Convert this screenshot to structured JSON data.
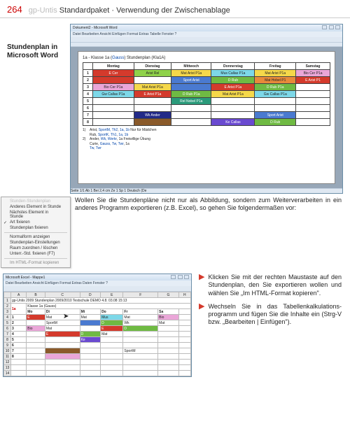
{
  "page": {
    "number": "264",
    "title_grey": "gp-Untis",
    "title_rest": " Standardpaket · Verwendung der Zwischenablage"
  },
  "caption1": "Stundenplan in Microsoft Word",
  "word": {
    "title": "Dokument2 - Microsoft Word",
    "menu": "Datei  Bearbeiten  Ansicht  Einfügen  Format  Extras  Tabelle  Fenster  ?",
    "doc_title_pre": "1a - Klasse 1a (",
    "doc_title_blue": "Gauss",
    "doc_title_post": ") Stundenplan (Kla1A)",
    "days": [
      "",
      "Montag",
      "Dienstag",
      "Mittwoch",
      "Donnerstag",
      "Freitag",
      "Samstag"
    ],
    "rows": [
      {
        "n": "1",
        "cells": [
          {
            "t": "E Cer",
            "c": "c-red"
          },
          {
            "t": "Arist  Rel",
            "c": "c-lime"
          },
          {
            "t": "Mat  Arist P1a",
            "c": "c-yellow"
          },
          {
            "t": "Mus Callas P1a",
            "c": "c-cyan"
          },
          {
            "t": "Mat  Arist P1a",
            "c": "c-yellow"
          },
          {
            "t": "Bio  Cer  P1a",
            "c": "c-pink"
          }
        ]
      },
      {
        "n": "2",
        "cells": [
          {
            "t": "",
            "c": "c-red"
          },
          {
            "t": "",
            "c": ""
          },
          {
            "t": "Sport  Arist",
            "c": "c-blue"
          },
          {
            "t": "D  Rub",
            "c": "c-lime2"
          },
          {
            "t": "Mat  Hobel P1",
            "c": "c-orange"
          },
          {
            "t": "E  Arist P1",
            "c": "c-red"
          }
        ]
      },
      {
        "n": "3",
        "cells": [
          {
            "t": "Bio  Cer P1a",
            "c": "c-pink"
          },
          {
            "t": "Mat  Arist P1a",
            "c": "c-yellow"
          },
          {
            "t": "",
            "c": "c-blue"
          },
          {
            "t": "E  Arist P1a",
            "c": "c-red"
          },
          {
            "t": "D  Rub  P1a",
            "c": "c-lime2"
          },
          {
            "t": "",
            "c": ""
          }
        ]
      },
      {
        "n": "4",
        "cells": [
          {
            "t": "Gw  Callas P1a",
            "c": "c-cyan"
          },
          {
            "t": "E  Arist P1a",
            "c": "c-red"
          },
          {
            "t": "D  Rub  P1a",
            "c": "c-lime2"
          },
          {
            "t": "Mat  Arist P1a",
            "c": "c-yellow"
          },
          {
            "t": "Gw  Callas P1a",
            "c": "c-cyan"
          },
          {
            "t": "",
            "c": ""
          }
        ]
      },
      {
        "n": "5",
        "cells": [
          {
            "t": "",
            "c": ""
          },
          {
            "t": "",
            "c": ""
          },
          {
            "t": "Rel  Nobel P1a",
            "c": "c-teal"
          },
          {
            "t": "",
            "c": ""
          },
          {
            "t": "",
            "c": ""
          },
          {
            "t": "",
            "c": ""
          }
        ]
      },
      {
        "n": "6",
        "cells": [
          {
            "t": "",
            "c": ""
          },
          {
            "t": "",
            "c": ""
          },
          {
            "t": "",
            "c": ""
          },
          {
            "t": "",
            "c": ""
          },
          {
            "t": "",
            "c": ""
          },
          {
            "t": "",
            "c": ""
          }
        ]
      },
      {
        "n": "7",
        "cells": [
          {
            "t": "",
            "c": ""
          },
          {
            "t": "Wk  Ander",
            "c": "c-navy"
          },
          {
            "t": "",
            "c": ""
          },
          {
            "t": "",
            "c": ""
          },
          {
            "t": "Sport  Arist",
            "c": "c-blue"
          },
          {
            "t": "",
            "c": ""
          }
        ]
      },
      {
        "n": "8",
        "cells": [
          {
            "t": "",
            "c": ""
          },
          {
            "t": "",
            "c": "c-brown"
          },
          {
            "t": "",
            "c": ""
          },
          {
            "t": "Ke  Callas",
            "c": "c-purp"
          },
          {
            "t": "D  Rub",
            "c": "c-lime2"
          },
          {
            "t": "",
            "c": ""
          }
        ]
      }
    ],
    "legend": [
      {
        "n": "1)",
        "a": "Arist, ",
        "b": "SportM, Th2",
        "c": ", ",
        "d": "1a, 1b",
        "e": "    Nur für Mädchen"
      },
      {
        "n": "",
        "a": "Rub, ",
        "b": "SportK, Th1",
        "c": ", ",
        "d": "1a, 1b",
        "e": ""
      },
      {
        "n": "2)",
        "a": "Ander, ",
        "b": "Wk, Werkr",
        "c": ", 1a",
        "d": "",
        "e": "    Freiwillige Übung"
      },
      {
        "n": "",
        "a": "Curie, ",
        "b": "Gauss, Tw, Twr",
        "c": ", 1a",
        "d": "",
        "e": ""
      },
      {
        "n": "",
        "a": " ",
        "b": "Tw, Twr",
        "c": "",
        "d": "",
        "e": ""
      }
    ],
    "status": "Seite   1/1    Ab 1    Bei 2,4 cm   Ze 1   Sp 1                    Deutsch (De"
  },
  "context_menu": {
    "items": [
      {
        "t": "Stunden-Stundenplan",
        "cls": "dis"
      },
      {
        "t": "Anderes Element in Stunde",
        "cls": ""
      },
      {
        "t": "Nächstes Element in Stunde",
        "cls": ""
      },
      {
        "t": "Art fixieren",
        "cls": "chk"
      },
      {
        "t": "Stundenplan fixieren",
        "cls": ""
      },
      {
        "t": "__sep__",
        "cls": ""
      },
      {
        "t": "Normalform anzeigen",
        "cls": ""
      },
      {
        "t": "Stundenplan-Einstellungen",
        "cls": ""
      },
      {
        "t": "Raum zuordnen / löschen",
        "cls": ""
      },
      {
        "t": "Unterr.-Std. fixieren (F7)",
        "cls": ""
      },
      {
        "t": "__sep__",
        "cls": ""
      },
      {
        "t": "Im HTML-Format kopieren",
        "cls": "sel"
      }
    ]
  },
  "body_para": "Wollen Sie die Stundenpläne nicht nur als Abbildung, sondern zum Weiterverarbeiten in ein anderes Programm exportieren (z.B. Excel), so gehen Sie folgendermaßen vor:",
  "excel": {
    "title": "Microsoft Excel - Mappe1",
    "menu": "Datei  Bearbeiten  Ansicht  Einfügen  Format  Extras  Daten  Fenster  ?",
    "cols": [
      "",
      "A",
      "B",
      "C",
      "D",
      "E",
      "F",
      "G",
      "H"
    ],
    "r1": [
      "1",
      "gp-Untis 2009 Stundenplan 2009/2010 Testschule DEMO 4.8. 03.08 15:13",
      "",
      "",
      "",
      "",
      "",
      "",
      ""
    ],
    "title_cell": "1a",
    "title_desc": "Klasse 1a (Gauss)",
    "hdr": [
      "",
      "",
      "Mo",
      "Di",
      "Mi",
      "Do",
      "Fr",
      "Sa",
      ""
    ],
    "rows": [
      {
        "n": "4",
        "p": "1",
        "c": [
          {
            "t": "E",
            "c": "c-red"
          },
          {
            "t": "Mat",
            "c": ""
          },
          {
            "t": "Mat",
            "c": ""
          },
          {
            "t": "Mus",
            "c": "c-cyan"
          },
          {
            "t": "Mat",
            "c": ""
          },
          {
            "t": "Bio",
            "c": "c-pink"
          }
        ]
      },
      {
        "n": "5",
        "p": "2",
        "c": [
          {
            "t": "",
            "c": ""
          },
          {
            "t": "SportM",
            "c": ""
          },
          {
            "t": "",
            "c": "c-blue"
          },
          {
            "t": "D",
            "c": "c-lime2"
          },
          {
            "t": "Wk",
            "c": ""
          },
          {
            "t": "Mat",
            "c": ""
          }
        ]
      },
      {
        "n": "6",
        "p": "3",
        "c": [
          {
            "t": "Bio",
            "c": "c-pink"
          },
          {
            "t": "Mat",
            "c": ""
          },
          {
            "t": "",
            "c": ""
          },
          {
            "t": "E",
            "c": "c-red"
          },
          {
            "t": "D",
            "c": "c-lime2"
          },
          {
            "t": "",
            "c": ""
          }
        ]
      },
      {
        "n": "7",
        "p": "4",
        "c": [
          {
            "t": "",
            "c": ""
          },
          {
            "t": "E",
            "c": "c-red"
          },
          {
            "t": "D",
            "c": "c-lime2"
          },
          {
            "t": "Mat",
            "c": ""
          },
          {
            "t": "",
            "c": ""
          },
          {
            "t": "",
            "c": ""
          }
        ]
      },
      {
        "n": "8",
        "p": "5",
        "c": [
          {
            "t": "",
            "c": ""
          },
          {
            "t": "",
            "c": ""
          },
          {
            "t": "Ke",
            "c": "c-purp"
          },
          {
            "t": "",
            "c": ""
          },
          {
            "t": "",
            "c": ""
          },
          {
            "t": "",
            "c": ""
          }
        ]
      },
      {
        "n": "9",
        "p": "6",
        "c": [
          {
            "t": "",
            "c": ""
          },
          {
            "t": "",
            "c": ""
          },
          {
            "t": "",
            "c": ""
          },
          {
            "t": "",
            "c": ""
          },
          {
            "t": "",
            "c": ""
          },
          {
            "t": "",
            "c": ""
          }
        ]
      },
      {
        "n": "10",
        "p": "7",
        "c": [
          {
            "t": "",
            "c": ""
          },
          {
            "t": "",
            "c": "c-brown"
          },
          {
            "t": "",
            "c": ""
          },
          {
            "t": "",
            "c": ""
          },
          {
            "t": "SportM",
            "c": ""
          },
          {
            "t": "",
            "c": ""
          }
        ]
      },
      {
        "n": "11",
        "p": "8",
        "c": [
          {
            "t": "",
            "c": ""
          },
          {
            "t": "",
            "c": "c-pink"
          },
          {
            "t": "",
            "c": ""
          },
          {
            "t": "",
            "c": ""
          },
          {
            "t": "",
            "c": ""
          },
          {
            "t": "",
            "c": ""
          }
        ]
      }
    ]
  },
  "steps": [
    "Klicken Sie mit der rechten Maustaste auf den Stundenplan, den Sie exportieren wollen und wählen Sie „Im HTML-Format kopieren\".",
    "Wechseln Sie in das Tabellenkalkulations­programm und fügen Sie die Inhalte ein (Strg-V bzw. „Bearbeiten | Einfügen\")."
  ]
}
